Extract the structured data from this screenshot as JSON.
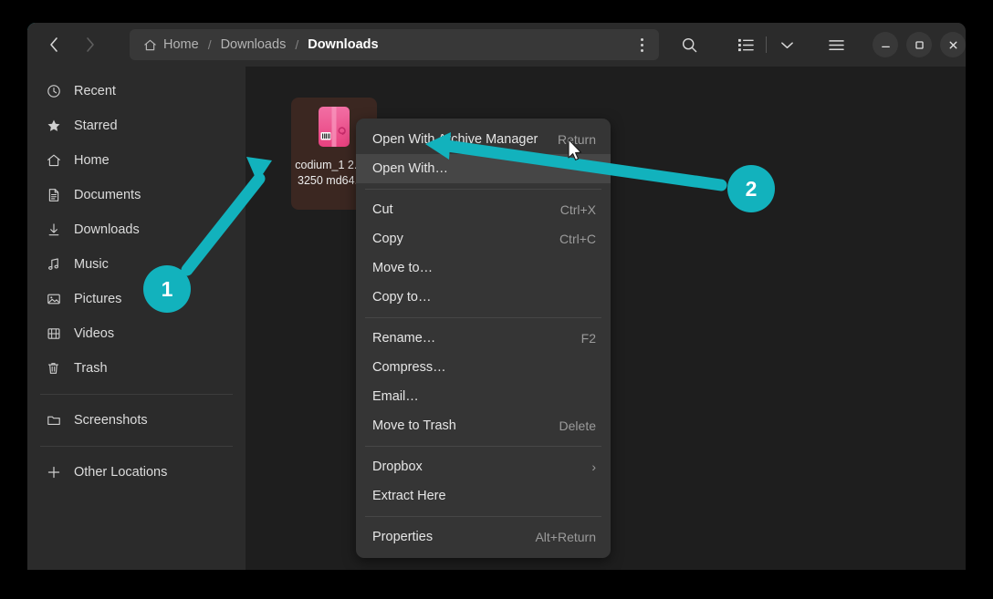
{
  "window": {
    "accent_color": "#12b2bd",
    "titlebar_bg": "#2b2b2b",
    "sidebar_bg": "#2b2b2b",
    "content_bg": "#1e1e1e",
    "menu_bg": "#353535"
  },
  "header": {
    "back_label": "Back",
    "forward_label": "Forward",
    "breadcrumbs": [
      {
        "label": "Home",
        "icon": "home-icon",
        "current": false
      },
      {
        "label": "Downloads",
        "icon": "",
        "current": false
      },
      {
        "label": "Downloads",
        "icon": "",
        "current": true
      }
    ],
    "path_options_label": "Path options",
    "search_label": "Search",
    "view_list_label": "List view",
    "view_dropdown_label": "View options",
    "main_menu_label": "Main menu",
    "minimize_label": "Minimize",
    "maximize_label": "Maximize",
    "close_label": "Close"
  },
  "sidebar": {
    "items": [
      {
        "label": "Recent",
        "icon": "clock-icon"
      },
      {
        "label": "Starred",
        "icon": "star-icon"
      },
      {
        "label": "Home",
        "icon": "home-icon"
      },
      {
        "label": "Documents",
        "icon": "document-icon"
      },
      {
        "label": "Downloads",
        "icon": "download-icon"
      },
      {
        "label": "Music",
        "icon": "music-note-icon"
      },
      {
        "label": "Pictures",
        "icon": "image-icon"
      },
      {
        "label": "Videos",
        "icon": "film-icon"
      },
      {
        "label": "Trash",
        "icon": "trash-icon"
      }
    ],
    "bookmarks": [
      {
        "label": "Screenshots",
        "icon": "folder-icon"
      }
    ],
    "other": [
      {
        "label": "Other Locations",
        "icon": "plus-icon"
      }
    ]
  },
  "content": {
    "files": [
      {
        "name": "codium_1 2.0.23250 md64.de",
        "icon": "deb-package-icon",
        "selected": true
      }
    ]
  },
  "context_menu": {
    "groups": [
      [
        {
          "label": "Open With Archive Manager",
          "accel": "Return",
          "selected": false,
          "submenu": false
        },
        {
          "label": "Open With…",
          "accel": "",
          "selected": true,
          "submenu": false
        }
      ],
      [
        {
          "label": "Cut",
          "accel": "Ctrl+X",
          "selected": false,
          "submenu": false
        },
        {
          "label": "Copy",
          "accel": "Ctrl+C",
          "selected": false,
          "submenu": false
        },
        {
          "label": "Move to…",
          "accel": "",
          "selected": false,
          "submenu": false
        },
        {
          "label": "Copy to…",
          "accel": "",
          "selected": false,
          "submenu": false
        }
      ],
      [
        {
          "label": "Rename…",
          "accel": "F2",
          "selected": false,
          "submenu": false
        },
        {
          "label": "Compress…",
          "accel": "",
          "selected": false,
          "submenu": false
        },
        {
          "label": "Email…",
          "accel": "",
          "selected": false,
          "submenu": false
        },
        {
          "label": "Move to Trash",
          "accel": "Delete",
          "selected": false,
          "submenu": false
        }
      ],
      [
        {
          "label": "Dropbox",
          "accel": "",
          "selected": false,
          "submenu": true
        },
        {
          "label": "Extract Here",
          "accel": "",
          "selected": false,
          "submenu": false
        }
      ],
      [
        {
          "label": "Properties",
          "accel": "Alt+Return",
          "selected": false,
          "submenu": false
        }
      ]
    ]
  },
  "annotations": {
    "badges": [
      {
        "number": "1",
        "target": "file-item"
      },
      {
        "number": "2",
        "target": "open-with-menu-item"
      }
    ]
  }
}
